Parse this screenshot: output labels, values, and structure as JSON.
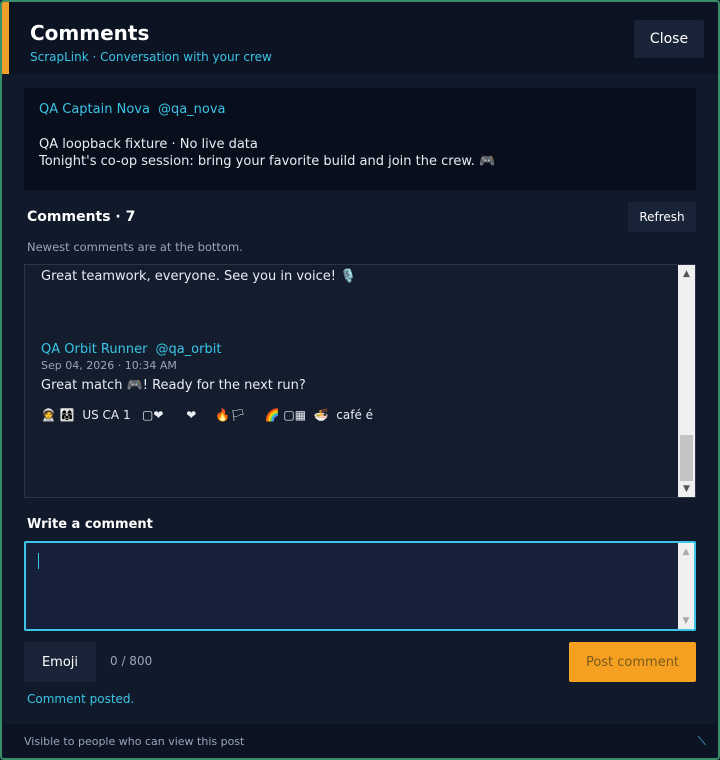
{
  "header": {
    "title": "Comments",
    "subtitle": "ScrapLink · Conversation with your crew",
    "close_label": "Close"
  },
  "post": {
    "author": "QA Captain Nova",
    "handle": "@qa_nova",
    "line1": "QA loopback fixture · No live data",
    "line2": "Tonight's co-op session: bring your favorite build and join the crew. 🎮"
  },
  "comments": {
    "heading": "Comments · 7",
    "refresh_label": "Refresh",
    "hint": "Newest comments are at the bottom.",
    "partial_text": "Great teamwork, everyone. See you in voice! 🎙️",
    "items": [
      {
        "author": "QA Orbit Runner",
        "handle": "@qa_orbit",
        "date": "Sep 04, 2026 · 10:34 AM",
        "text": "Great match 🎮! Ready for the next run?",
        "emoji_row": "🧑‍🚀 👩‍👩‍👧  US CA 1   ▢❤      ❤     🔥🏳     🌈 ▢▦  🍜  café é"
      }
    ]
  },
  "compose": {
    "label": "Write a comment",
    "placeholder": "",
    "value": "",
    "emoji_label": "Emoji",
    "char_count": "0 / 800",
    "post_label": "Post comment",
    "status": "Comment posted."
  },
  "footer": {
    "text": "Visible to people who can view this post"
  },
  "colors": {
    "accent": "#f0a02a",
    "link": "#3bc4e6",
    "background": "#111a2b"
  }
}
